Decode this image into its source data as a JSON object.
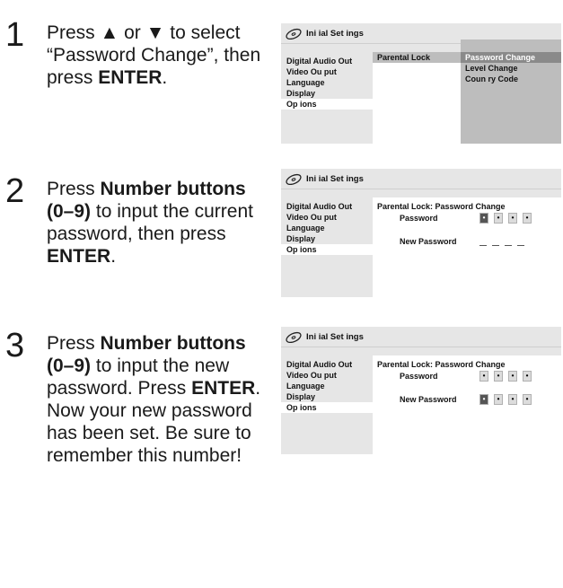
{
  "steps": [
    {
      "number": "1",
      "text_parts": [
        "Press ▲ or ▼ to select “Password Change”, then press ",
        "ENTER",
        "."
      ]
    },
    {
      "number": "2",
      "text_parts": [
        "Press ",
        "Number buttons (0–9)",
        " to input the current password, then press ",
        "ENTER",
        "."
      ]
    },
    {
      "number": "3",
      "text_parts": [
        "Press ",
        "Number buttons (0–9)",
        " to input the new password. Press ",
        "ENTER",
        ". Now your new password has been set. Be sure to remember this number!"
      ]
    }
  ],
  "screen1": {
    "title": "Ini ial Set ings",
    "menu": [
      "Digital Audio Out",
      "Video Ou put",
      "Language",
      "Display",
      "Op ions"
    ],
    "active_menu_index": 4,
    "submenu": "Parental Lock",
    "options": [
      "Password Change",
      "Level Change",
      "Coun ry Code"
    ],
    "selected_option_index": 0
  },
  "screen2": {
    "title": "Ini ial Set ings",
    "menu": [
      "Digital Audio Out",
      "Video Ou put",
      "Language",
      "Display",
      "Op ions"
    ],
    "active_menu_index": 4,
    "header": "Parental Lock: Password Change",
    "password_label": "Password",
    "new_password_label": "New Password",
    "password_boxes": [
      "•",
      "•",
      "•",
      "•"
    ],
    "new_password_boxes": [
      "",
      "",
      "",
      ""
    ]
  },
  "screen3": {
    "title": "Ini ial Set ings",
    "menu": [
      "Digital Audio Out",
      "Video Ou put",
      "Language",
      "Display",
      "Op ions"
    ],
    "active_menu_index": 4,
    "header": "Parental Lock: Password Change",
    "password_label": "Password",
    "new_password_label": "New Password",
    "password_boxes": [
      "•",
      "•",
      "•",
      "•"
    ],
    "new_password_boxes": [
      "•",
      "•",
      "•",
      "•"
    ]
  },
  "colors": {
    "screen_bg": "#e6e6e6",
    "highlight": "#8a8a8a",
    "pane_bg": "#ffffff",
    "text": "#1a1a1a"
  },
  "icons": {
    "screen_title_icon": "disc-icon"
  }
}
